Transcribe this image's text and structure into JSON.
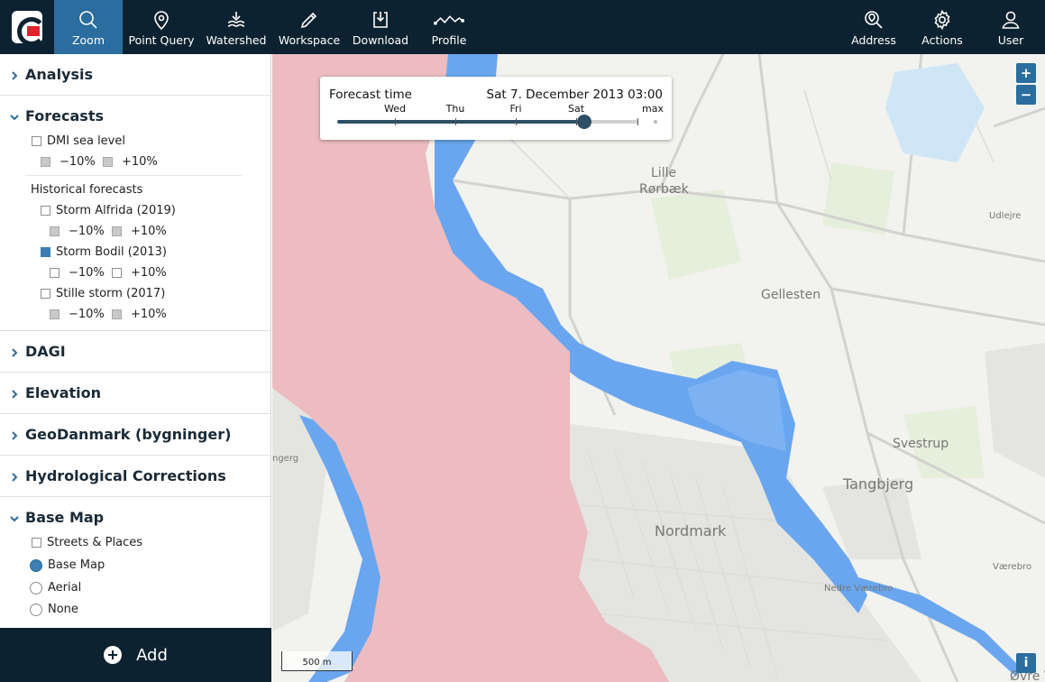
{
  "toolbar": {
    "items": [
      {
        "label": "Zoom",
        "icon": "search-icon"
      },
      {
        "label": "Point Query",
        "icon": "map-pin-icon"
      },
      {
        "label": "Watershed",
        "icon": "water-icon"
      },
      {
        "label": "Workspace",
        "icon": "pencil-icon"
      },
      {
        "label": "Download",
        "icon": "download-icon"
      },
      {
        "label": "Profile",
        "icon": "profile-line-icon"
      }
    ],
    "right": [
      {
        "label": "Address",
        "icon": "address-search-icon"
      },
      {
        "label": "Actions",
        "icon": "gear-icon"
      },
      {
        "label": "User",
        "icon": "user-icon"
      }
    ],
    "active": "Zoom"
  },
  "sidebar": {
    "analysis": "Analysis",
    "forecasts": {
      "title": "Forecasts",
      "dmi": "DMI sea level",
      "minus": "−10%",
      "plus": "+10%",
      "historical": "Historical forecasts",
      "alfrida": "Storm Alfrida (2019)",
      "bodil": "Storm Bodil (2013)",
      "stille": "Stille storm (2017)"
    },
    "dagi": "DAGI",
    "elevation": "Elevation",
    "geodanmark": "GeoDanmark (bygninger)",
    "hydro": "Hydrological Corrections",
    "basemap": {
      "title": "Base Map",
      "streets": "Streets & Places",
      "base": "Base Map",
      "aerial": "Aerial",
      "none": "None",
      "selected": "Base Map"
    }
  },
  "add_label": "Add",
  "map": {
    "forecast_label": "Forecast time",
    "forecast_value": "Sat 7. December 2013 03:00",
    "ticks": [
      "Wed",
      "Thu",
      "Fri",
      "Sat",
      "max"
    ],
    "slider_position": 0.82,
    "zoom_in": "+",
    "zoom_out": "−",
    "info": "i",
    "scale": "500 m",
    "places": {
      "lille": "Lille",
      "rorbaek": "Rørbæk",
      "udlejre": "Udlejre",
      "gellesten": "Gellesten",
      "svestrup": "Svestrup",
      "tangbjerg": "Tangbjerg",
      "nordmark": "Nordmark",
      "vaerebro": "Værebro",
      "nedre": "Nedre Værebro",
      "ovre": "Øvre V",
      "ngerg": "ngerg"
    },
    "colors": {
      "water": "#ecbcc0",
      "flood": "#6aa6ef",
      "land": "#f2f2ef",
      "urban": "#e4e4e1"
    }
  }
}
